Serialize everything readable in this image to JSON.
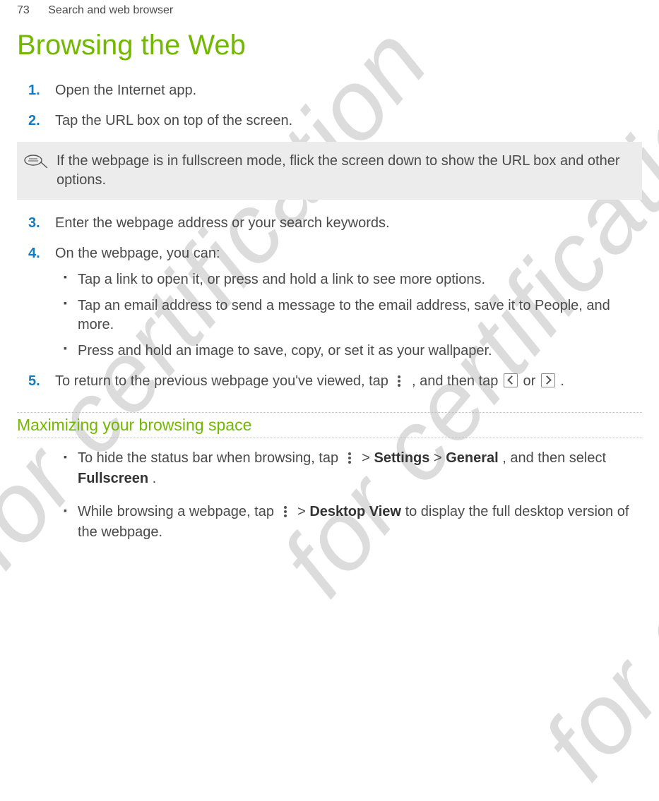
{
  "header": {
    "page_number": "73",
    "section": "Search and web browser"
  },
  "title": "Browsing the Web",
  "watermark": "for certification",
  "steps": {
    "s1": {
      "num": "1.",
      "text": "Open the Internet app."
    },
    "s2": {
      "num": "2.",
      "text": "Tap the URL box on top of the screen."
    },
    "s3": {
      "num": "3.",
      "text": "Enter the webpage address or your search keywords."
    },
    "s4": {
      "num": "4.",
      "text": "On the webpage, you can:",
      "sub": [
        "Tap a link to open it, or press and hold a link to see more options.",
        "Tap an email address to send a message to the email address, save it to People, and more.",
        "Press and hold an image to save, copy, or set it as your wallpaper."
      ]
    },
    "s5": {
      "num": "5.",
      "pre": "To return to the previous webpage you've viewed, tap ",
      "mid": ", and then tap ",
      "or": " or ",
      "end": "."
    }
  },
  "tip": "If the webpage is in fullscreen mode, flick the screen down to show the URL box and other options.",
  "subheading": "Maximizing your browsing space",
  "bullets": {
    "b1": {
      "pre": "To hide the status bar when browsing, tap ",
      "mid1": " > ",
      "settings": "Settings",
      "mid2": " > ",
      "general": "General",
      "mid3": ", and then select ",
      "fullscreen": "Fullscreen",
      "end": "."
    },
    "b2": {
      "pre": "While browsing a webpage, tap ",
      "mid1": " > ",
      "desktop": "Desktop View",
      "end": " to display the full desktop version of the webpage."
    }
  }
}
